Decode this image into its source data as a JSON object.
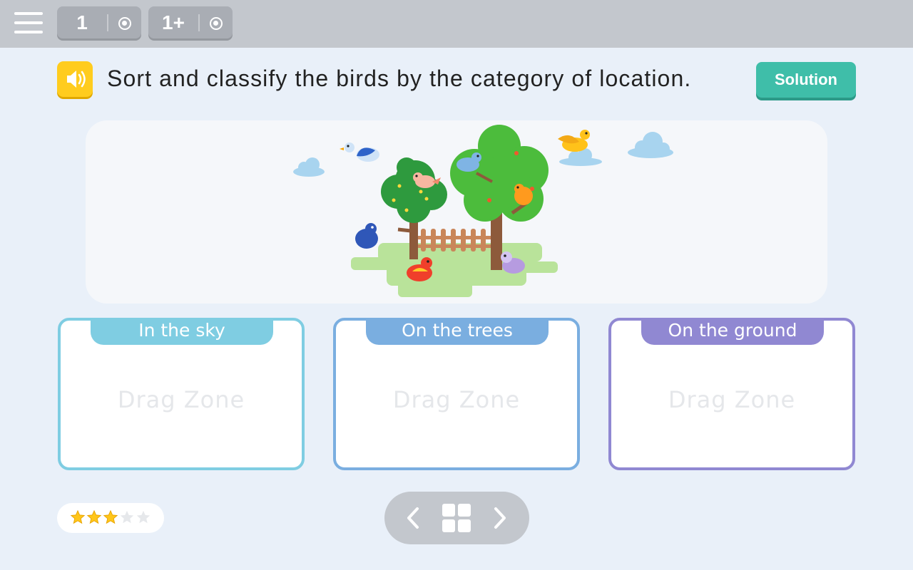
{
  "topbar": {
    "menu_icon": "hamburger-menu-icon",
    "levels": [
      {
        "label": "1",
        "icon": "target-icon"
      },
      {
        "label": "1+",
        "icon": "target-icon"
      }
    ]
  },
  "question": {
    "audio_icon": "speaker-icon",
    "text": "Sort and classify the birds by the category of location.",
    "solution_label": "Solution"
  },
  "scene": {
    "image": "birds-trees-fence-illustration"
  },
  "zones": [
    {
      "title": "In the sky",
      "placeholder": "Drag Zone",
      "color": "#7fcde2"
    },
    {
      "title": "On the trees",
      "placeholder": "Drag Zone",
      "color": "#7aaee0"
    },
    {
      "title": "On the ground",
      "placeholder": "Drag Zone",
      "color": "#9088d2"
    }
  ],
  "rating": {
    "filled": 3,
    "total": 5
  },
  "nav": {
    "prev_icon": "chevron-left-icon",
    "grid_icon": "grid-icon",
    "next_icon": "chevron-right-icon"
  },
  "colors": {
    "accent_solution": "#3fbea9",
    "speaker": "#ffcc1e",
    "star": "#ffc61a",
    "star_empty": "#e6e8eb"
  }
}
